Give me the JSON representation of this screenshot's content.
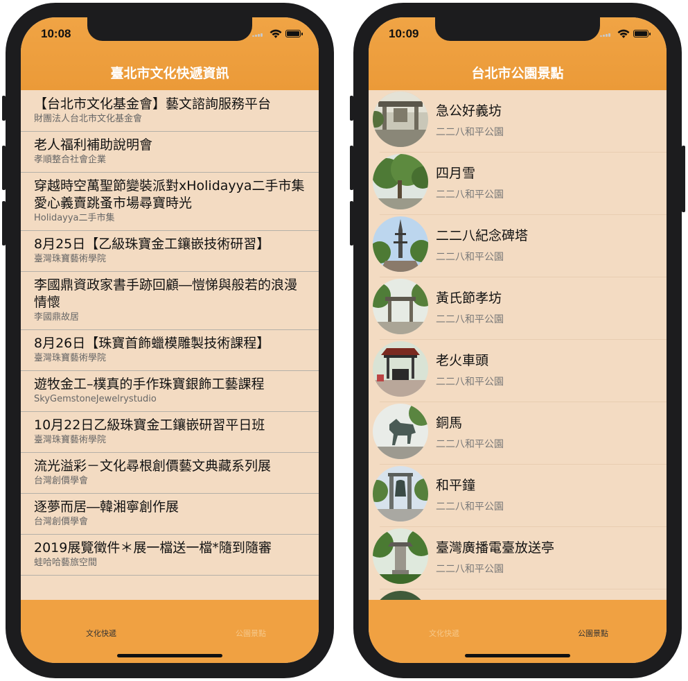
{
  "left_phone": {
    "time": "10:08",
    "title": "臺北市文化快遞資訊",
    "items": [
      {
        "title": "【台北市文化基金會】藝文諮詢服務平台",
        "sub": "財團法人台北市文化基金會"
      },
      {
        "title": "老人福利補助說明會",
        "sub": "孝順整合社會企業"
      },
      {
        "title": "穿越時空萬聖節變裝派對xHolidayya二手市集愛心義賣跳蚤市場尋寶時光",
        "sub": "Holidayya二手市集"
      },
      {
        "title": "8月25日【乙級珠寶金工鑲嵌技術研習】",
        "sub": "臺灣珠寶藝術學院"
      },
      {
        "title": "李國鼎資政家書手跡回顧―愷悌與般若的浪漫情懷",
        "sub": "李國鼎故居"
      },
      {
        "title": "8月26日【珠寶首飾蠟模雕製技術課程】",
        "sub": "臺灣珠寶藝術學院"
      },
      {
        "title": "遊牧金工–樸真的手作珠寶銀飾工藝課程",
        "sub": "SkyGemstoneJewelrystudio"
      },
      {
        "title": "10月22日乙級珠寶金工鑲嵌研習平日班",
        "sub": "臺灣珠寶藝術學院"
      },
      {
        "title": "流光溢彩－文化尋根創價藝文典藏系列展",
        "sub": "台灣創價學會"
      },
      {
        "title": "逐夢而居―韓湘寧創作展",
        "sub": "台灣創價學會"
      },
      {
        "title": "2019展覽徵件＊展一檔送一檔*隨到隨審",
        "sub": "蛙哈哈藝旅空間"
      }
    ],
    "tabs": [
      "文化快遞",
      "公園景點"
    ]
  },
  "right_phone": {
    "time": "10:09",
    "title": "台北市公園景點",
    "items": [
      {
        "name": "急公好義坊",
        "park": "二二八和平公園"
      },
      {
        "name": "四月雪",
        "park": "二二八和平公園"
      },
      {
        "name": "二二八紀念碑塔",
        "park": "二二八和平公園"
      },
      {
        "name": "黃氏節孝坊",
        "park": "二二八和平公園"
      },
      {
        "name": "老火車頭",
        "park": "二二八和平公園"
      },
      {
        "name": "銅馬",
        "park": "二二八和平公園"
      },
      {
        "name": "和平鐘",
        "park": "二二八和平公園"
      },
      {
        "name": "臺灣廣播電臺放送亭",
        "park": "二二八和平公園"
      }
    ],
    "tabs": [
      "文化快遞",
      "公園景點"
    ]
  },
  "colors": {
    "accent": "#f0a142",
    "list_background": "#f3dbc2",
    "tab_active": "#333333",
    "tab_inactive": "#f6c889"
  }
}
